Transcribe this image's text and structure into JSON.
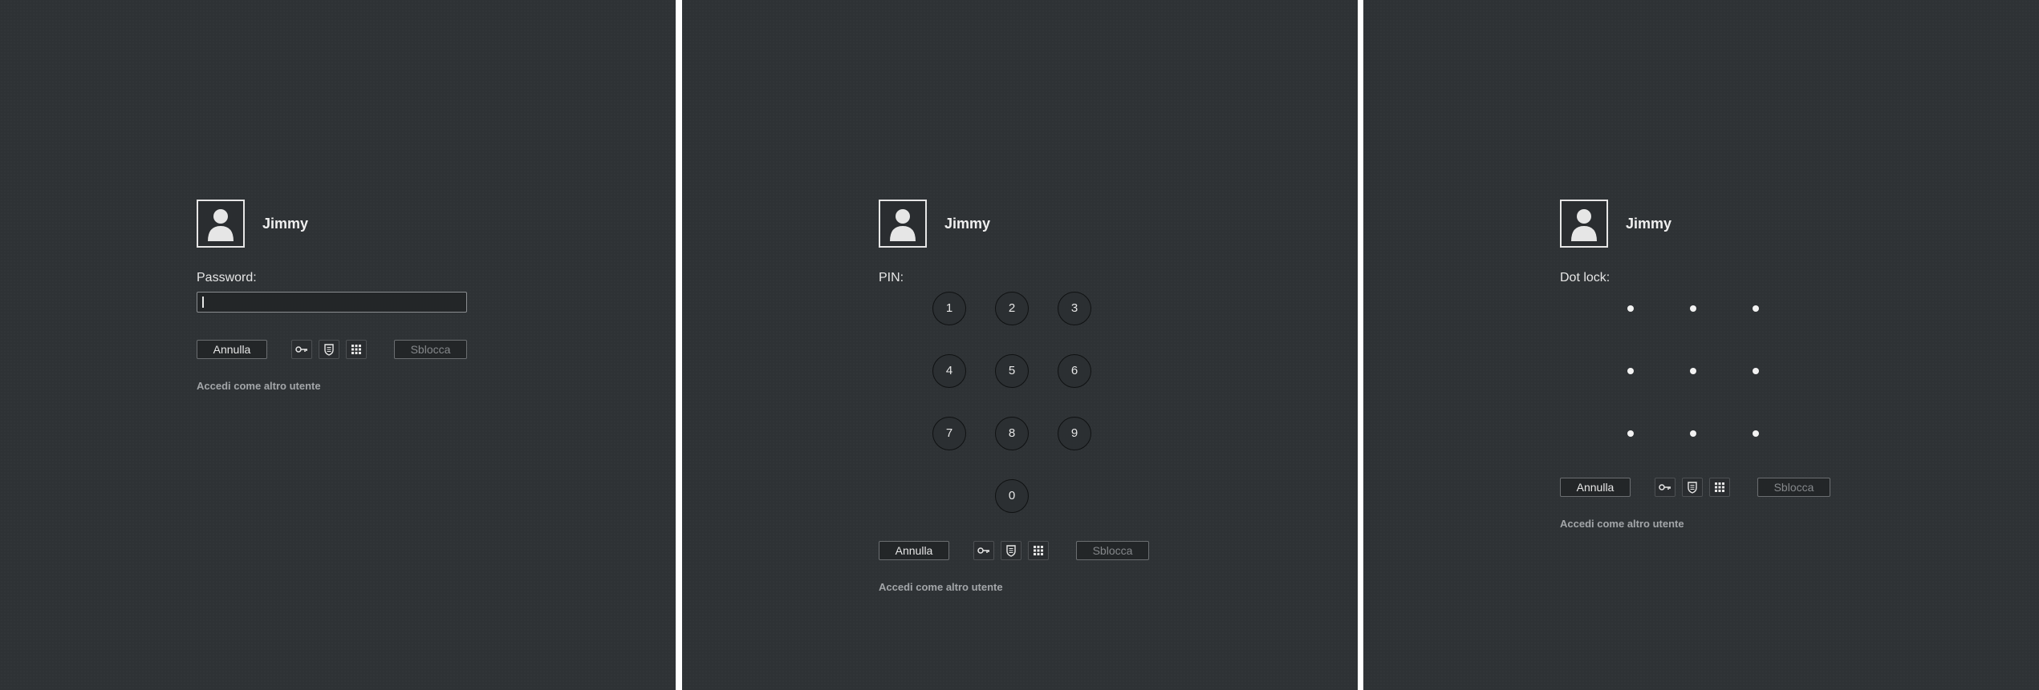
{
  "user": {
    "name": "Jimmy"
  },
  "password_panel": {
    "field_label": "Password:",
    "input_value": "",
    "cancel_label": "Annulla",
    "unlock_label": "Sblocca",
    "other_user_label": "Accedi come altro utente"
  },
  "pin_panel": {
    "field_label": "PIN:",
    "keys": [
      "1",
      "2",
      "3",
      "4",
      "5",
      "6",
      "7",
      "8",
      "9",
      "0"
    ],
    "cancel_label": "Annulla",
    "unlock_label": "Sblocca",
    "other_user_label": "Accedi come altro utente"
  },
  "dot_panel": {
    "field_label": "Dot lock:",
    "grid": "3x3",
    "cancel_label": "Annulla",
    "unlock_label": "Sblocca",
    "other_user_label": "Accedi come altro utente"
  },
  "auth_modes": [
    "key-icon",
    "shield-icon",
    "grid-icon"
  ],
  "colors": {
    "background": "#2e3235",
    "separator": "#ffffff",
    "text": "#e6e6e6",
    "muted": "#a3a6a9"
  }
}
